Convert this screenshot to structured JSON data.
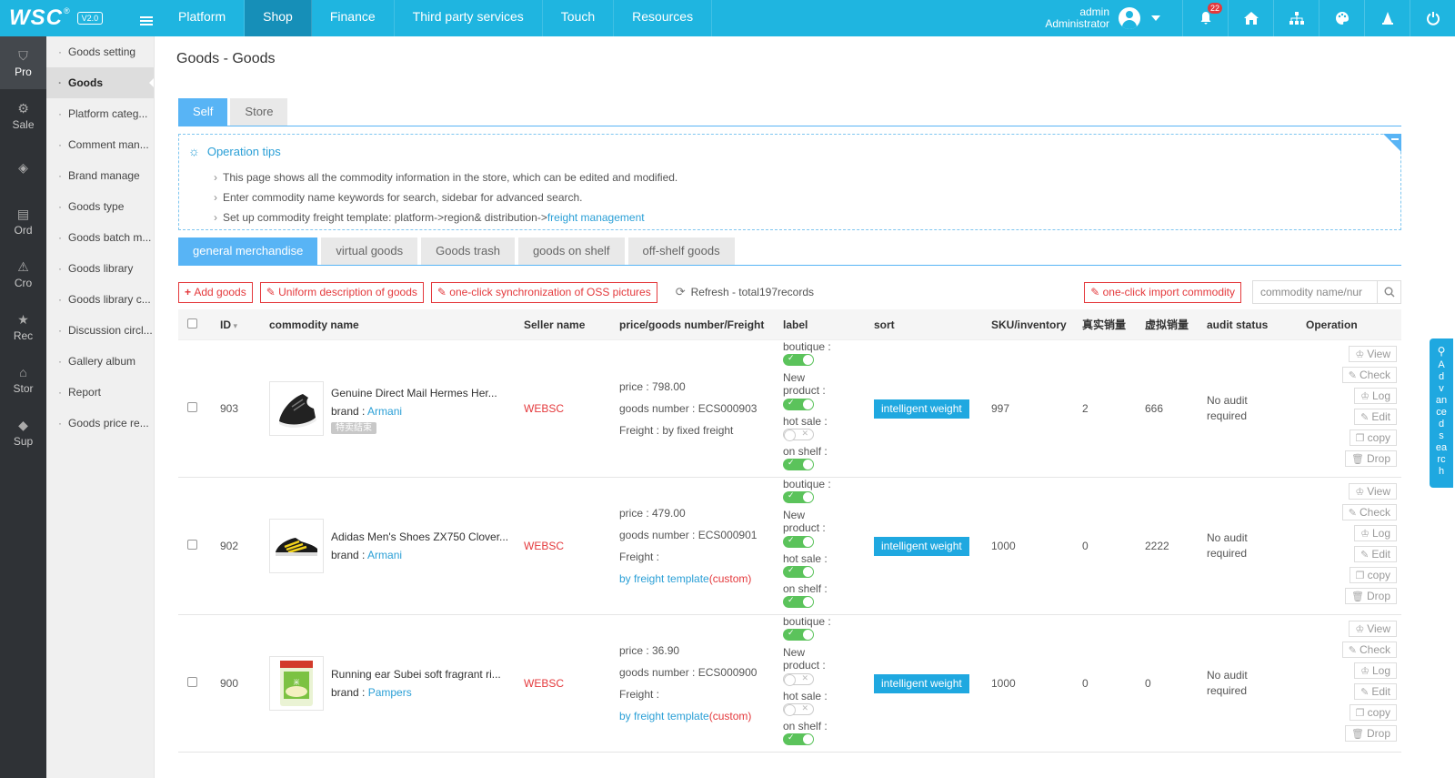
{
  "topbar": {
    "logo": "WSC",
    "logo_reg": "®",
    "version": "V2.0",
    "nav": [
      {
        "label": "Platform",
        "active": false
      },
      {
        "label": "Shop",
        "active": true
      },
      {
        "label": "Finance",
        "active": false
      },
      {
        "label": "Third party services",
        "active": false
      },
      {
        "label": "Touch",
        "active": false
      },
      {
        "label": "Resources",
        "active": false
      }
    ],
    "user_name": "admin",
    "user_role": "Administrator",
    "notification_count": "22",
    "accent": "#1fb5e0"
  },
  "iconbar": [
    {
      "label": "Pro",
      "icon": "bag-icon",
      "glyph": "⛉",
      "active": true
    },
    {
      "label": "Sale",
      "icon": "sale-icon",
      "glyph": "⚙",
      "active": false
    },
    {
      "label": "",
      "icon": "tag-icon",
      "glyph": "◈",
      "active": false
    },
    {
      "label": "Ord",
      "icon": "order-icon",
      "glyph": "▤",
      "active": false
    },
    {
      "label": "Cro",
      "icon": "crowd-icon",
      "glyph": "⚠",
      "active": false
    },
    {
      "label": "Rec",
      "icon": "star-icon",
      "glyph": "★",
      "active": false
    },
    {
      "label": "Stor",
      "icon": "store-icon",
      "glyph": "⌂",
      "active": false
    },
    {
      "label": "Sup",
      "icon": "box-icon",
      "glyph": "◆",
      "active": false
    }
  ],
  "subbar": [
    {
      "label": "Goods setting",
      "active": false
    },
    {
      "label": "Goods",
      "active": true
    },
    {
      "label": "Platform categ...",
      "active": false
    },
    {
      "label": "Comment man...",
      "active": false
    },
    {
      "label": "Brand manage",
      "active": false
    },
    {
      "label": "Goods type",
      "active": false
    },
    {
      "label": "Goods batch m...",
      "active": false
    },
    {
      "label": "Goods library",
      "active": false
    },
    {
      "label": "Goods library c...",
      "active": false
    },
    {
      "label": "Discussion circl...",
      "active": false
    },
    {
      "label": "Gallery album",
      "active": false
    },
    {
      "label": "Report",
      "active": false
    },
    {
      "label": "Goods price re...",
      "active": false
    }
  ],
  "page": {
    "title": "Goods - Goods",
    "tabs": [
      {
        "label": "Self",
        "active": true
      },
      {
        "label": "Store",
        "active": false
      }
    ],
    "tips_title": "Operation tips",
    "tips": [
      "This page shows all the commodity information in the store, which can be edited and modified.",
      "Enter commodity name keywords for search, sidebar for advanced search.",
      "Set up commodity freight template: platform->region& distribution->"
    ],
    "tips_link": "freight management",
    "sub_tabs": [
      {
        "label": "general merchandise",
        "active": true
      },
      {
        "label": "virtual goods",
        "active": false
      },
      {
        "label": "Goods trash",
        "active": false
      },
      {
        "label": "goods on shelf",
        "active": false
      },
      {
        "label": "off-shelf goods",
        "active": false
      }
    ]
  },
  "toolbar": {
    "add": "Add goods",
    "uniform": "Uniform description of goods",
    "oss": "one-click synchronization of OSS pictures",
    "refresh": "Refresh - total197records",
    "import": "one-click import commodity",
    "search_placeholder": "commodity name/nur"
  },
  "table": {
    "headers": {
      "id": "ID",
      "name": "commodity name",
      "seller": "Seller name",
      "price": "price/goods number/Freight",
      "label": "label",
      "sort": "sort",
      "sku": "SKU/inventory",
      "real": "真实销量",
      "virtual": "虚拟销量",
      "audit": "audit status",
      "op": "Operation"
    },
    "label_names": {
      "boutique": "boutique :",
      "new1": "New",
      "new2": "product :",
      "hot": "hot sale :",
      "shelf": "on shelf :"
    },
    "op_labels": [
      "View",
      "Check",
      "Log",
      "Edit",
      "copy",
      "Drop"
    ],
    "rows": [
      {
        "id": "903",
        "name": "Genuine Direct Mail Hermes Her...",
        "brand_label": "brand :",
        "brand": "Armani",
        "tag": "特卖结束",
        "image": "black-sneaker",
        "seller": "WEBSC",
        "price": "price : 798.00",
        "goods_number": "goods number : ECS000903",
        "freight": "Freight : by fixed freight",
        "freight_link": "",
        "freight_custom": "",
        "boutique": true,
        "new_product": true,
        "hot_sale": false,
        "on_shelf": true,
        "sort": "intelligent weight",
        "sku": "997",
        "real_sales": "2",
        "virtual_sales": "666",
        "audit": "No audit required"
      },
      {
        "id": "902",
        "name": "Adidas Men's Shoes ZX750 Clover...",
        "brand_label": "brand :",
        "brand": "Armani",
        "tag": "",
        "image": "yellow-black-sneaker",
        "seller": "WEBSC",
        "price": "price : 479.00",
        "goods_number": "goods number : ECS000901",
        "freight": "Freight :",
        "freight_link": "by freight template",
        "freight_custom": "(custom)",
        "boutique": true,
        "new_product": true,
        "hot_sale": true,
        "on_shelf": true,
        "sort": "intelligent weight",
        "sku": "1000",
        "real_sales": "0",
        "virtual_sales": "2222",
        "audit": "No audit required"
      },
      {
        "id": "900",
        "name": "Running ear Subei soft fragrant ri...",
        "brand_label": "brand :",
        "brand": "Pampers",
        "tag": "",
        "image": "green-package",
        "seller": "WEBSC",
        "price": "price : 36.90",
        "goods_number": "goods number : ECS000900",
        "freight": "Freight :",
        "freight_link": "by freight template",
        "freight_custom": "(custom)",
        "boutique": true,
        "new_product": false,
        "hot_sale": false,
        "on_shelf": true,
        "sort": "intelligent weight",
        "sku": "1000",
        "real_sales": "0",
        "virtual_sales": "0",
        "audit": "No audit required"
      }
    ]
  },
  "adv_search": "Advanced search"
}
